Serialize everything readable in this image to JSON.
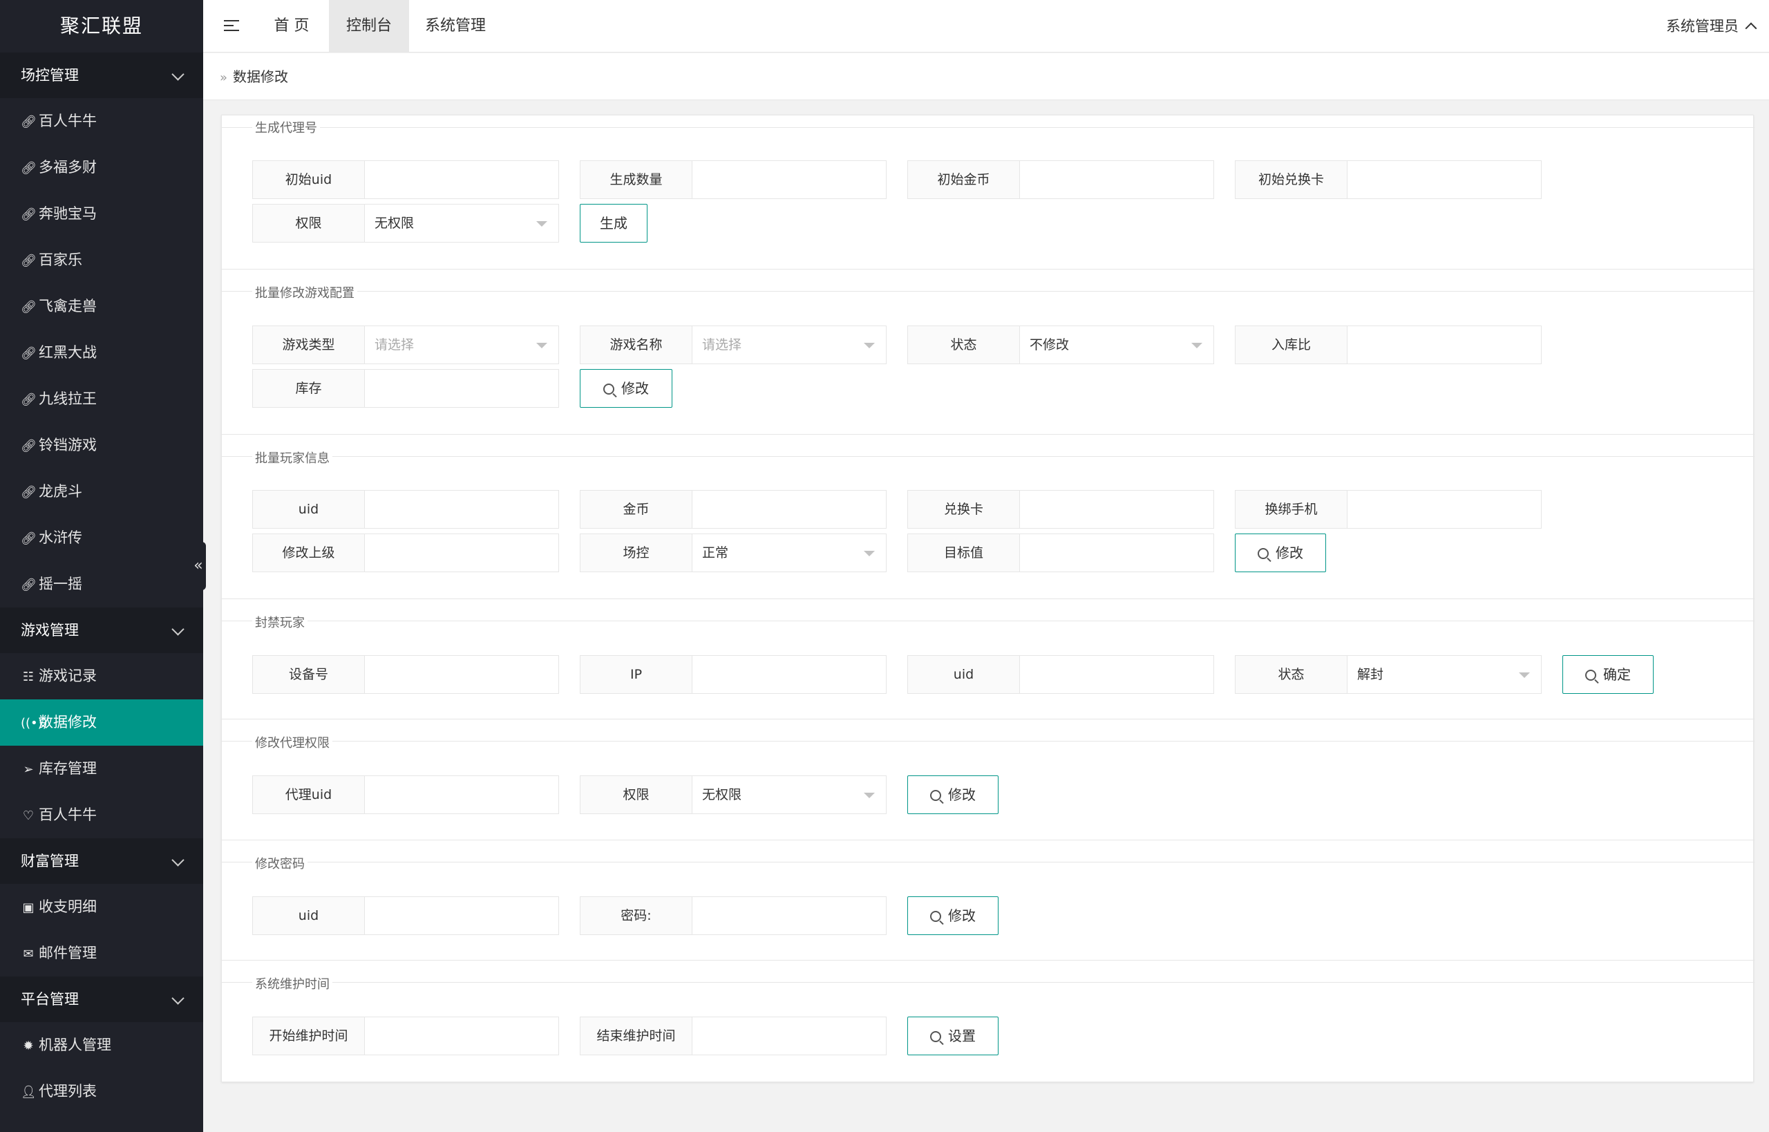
{
  "app": {
    "title": "聚汇联盟"
  },
  "topbar": {
    "tabs": [
      {
        "label": "首 页"
      },
      {
        "label": "控制台"
      },
      {
        "label": "系统管理"
      }
    ],
    "user": "系统管理员"
  },
  "sidebar": {
    "groups": [
      {
        "label": "场控管理",
        "items": [
          {
            "icon": "link-icon",
            "label": "百人牛牛"
          },
          {
            "icon": "link-icon",
            "label": "多福多财"
          },
          {
            "icon": "link-icon",
            "label": "奔驰宝马"
          },
          {
            "icon": "link-icon",
            "label": "百家乐"
          },
          {
            "icon": "link-icon",
            "label": "飞禽走兽"
          },
          {
            "icon": "link-icon",
            "label": "红黑大战"
          },
          {
            "icon": "link-icon",
            "label": "九线拉王"
          },
          {
            "icon": "link-icon",
            "label": "铃铛游戏"
          },
          {
            "icon": "link-icon",
            "label": "龙虎斗"
          },
          {
            "icon": "link-icon",
            "label": "水浒传"
          },
          {
            "icon": "link-icon",
            "label": "摇一摇"
          }
        ]
      },
      {
        "label": "游戏管理",
        "items": [
          {
            "icon": "list-icon",
            "label": "游戏记录"
          },
          {
            "icon": "broadcast-icon",
            "label": "数据修改",
            "active": true
          },
          {
            "icon": "send-icon",
            "label": "库存管理"
          },
          {
            "icon": "heart-icon",
            "label": "百人牛牛"
          }
        ]
      },
      {
        "label": "财富管理",
        "items": [
          {
            "icon": "calendar-icon",
            "label": "收支明细"
          },
          {
            "icon": "mail-icon",
            "label": "邮件管理"
          }
        ]
      },
      {
        "label": "平台管理",
        "items": [
          {
            "icon": "bug-icon",
            "label": "机器人管理"
          },
          {
            "icon": "user-icon",
            "label": "代理列表"
          }
        ]
      }
    ]
  },
  "breadcrumb": {
    "current": "数据修改"
  },
  "sections": {
    "generate_agent": {
      "legend": "生成代理号",
      "start_uid": {
        "label": "初始uid",
        "value": ""
      },
      "count": {
        "label": "生成数量",
        "value": ""
      },
      "start_gold": {
        "label": "初始金币",
        "value": ""
      },
      "start_card": {
        "label": "初始兑换卡",
        "value": ""
      },
      "permission": {
        "label": "权限",
        "value": "无权限"
      },
      "button": "生成"
    },
    "batch_game_config": {
      "legend": "批量修改游戏配置",
      "game_type": {
        "label": "游戏类型",
        "placeholder": "请选择"
      },
      "game_name": {
        "label": "游戏名称",
        "placeholder": "请选择"
      },
      "status": {
        "label": "状态",
        "value": "不修改"
      },
      "storage_ratio": {
        "label": "入库比",
        "value": ""
      },
      "stock": {
        "label": "库存",
        "value": ""
      },
      "button": "修改"
    },
    "batch_player": {
      "legend": "批量玩家信息",
      "uid": {
        "label": "uid",
        "value": ""
      },
      "gold": {
        "label": "金币",
        "value": ""
      },
      "card": {
        "label": "兑换卡",
        "value": ""
      },
      "rebind_phone": {
        "label": "换绑手机",
        "value": ""
      },
      "parent": {
        "label": "修改上级",
        "value": ""
      },
      "control": {
        "label": "场控",
        "value": "正常"
      },
      "target": {
        "label": "目标值",
        "value": ""
      },
      "button": "修改"
    },
    "ban_player": {
      "legend": "封禁玩家",
      "device": {
        "label": "设备号",
        "value": ""
      },
      "ip": {
        "label": "IP",
        "value": ""
      },
      "uid": {
        "label": "uid",
        "value": ""
      },
      "status": {
        "label": "状态",
        "value": "解封"
      },
      "button": "确定"
    },
    "agent_permission": {
      "legend": "修改代理权限",
      "agent_uid": {
        "label": "代理uid",
        "value": ""
      },
      "permission": {
        "label": "权限",
        "value": "无权限"
      },
      "button": "修改"
    },
    "change_password": {
      "legend": "修改密码",
      "uid": {
        "label": "uid",
        "value": ""
      },
      "password": {
        "label": "密码:",
        "value": ""
      },
      "button": "修改"
    },
    "maintenance": {
      "legend": "系统维护时间",
      "start": {
        "label": "开始维护时间",
        "value": ""
      },
      "end": {
        "label": "结束维护时间",
        "value": ""
      },
      "button": "设置"
    }
  }
}
